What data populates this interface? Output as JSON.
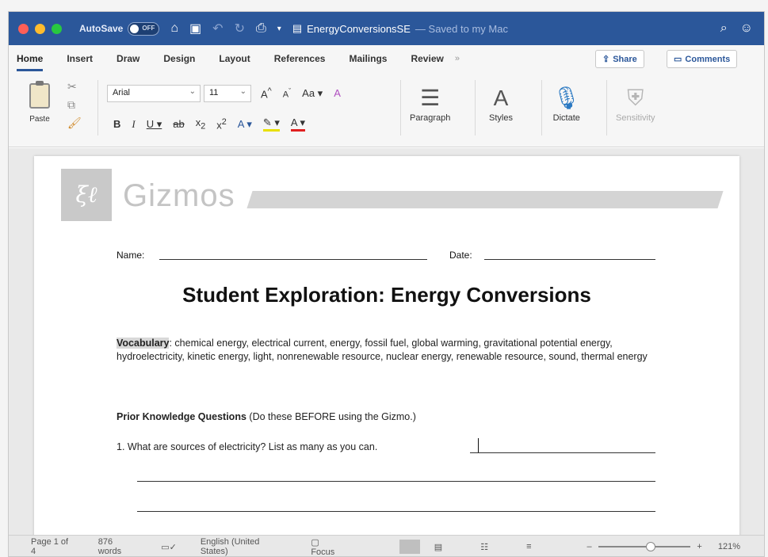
{
  "titlebar": {
    "autosave_label": "AutoSave",
    "autosave_state": "OFF",
    "doc_name": "EnergyConversionsSE",
    "saved_status": "— Saved to my Mac",
    "colors": {
      "bar": "#2b579a",
      "close": "#ff5f57",
      "minimize": "#febc2e",
      "zoom": "#28c840"
    }
  },
  "tabs": [
    "Home",
    "Insert",
    "Draw",
    "Design",
    "Layout",
    "References",
    "Mailings",
    "Review"
  ],
  "tabs_more": "»",
  "share_label": "Share",
  "comments_label": "Comments",
  "ribbon": {
    "paste_label": "Paste",
    "font_name": "Arial",
    "font_size": "11",
    "paragraph_label": "Paragraph",
    "styles_label": "Styles",
    "dictate_label": "Dictate",
    "sensitivity_label": "Sensitivity"
  },
  "document": {
    "brand": "Gizmos",
    "name_label": "Name:",
    "date_label": "Date:",
    "title": "Student Exploration: Energy Conversions",
    "vocab_label": "Vocabulary",
    "vocab_text": ": chemical energy, electrical current, energy, fossil fuel, global warming, gravitational potential energy, hydroelectricity, kinetic energy, light, nonrenewable resource, nuclear energy, renewable resource, sound, thermal energy",
    "prior_label": "Prior Knowledge Questions",
    "prior_note": "(Do these BEFORE using the Gizmo.)",
    "q1": "1.   What are sources of electricity? List as many as you can."
  },
  "status": {
    "page": "Page 1 of 4",
    "words": "876 words",
    "language": "English (United States)",
    "focus": "Focus",
    "zoom": "121%"
  }
}
